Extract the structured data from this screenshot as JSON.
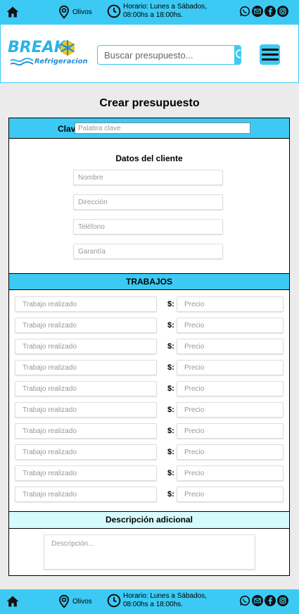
{
  "topbar": {
    "location": "Olivos",
    "hours": "Horario: Lunes a Sábados, 08:00hs a 18:00hs."
  },
  "header": {
    "logo_main": "BREAK",
    "logo_sub": "Refrigeracion",
    "search_placeholder": "Buscar presupuesto..."
  },
  "page": {
    "title": "Crear presupuesto"
  },
  "form": {
    "clave_label": "Clave:",
    "clave_placeholder": "Palabra clave",
    "client_title": "Datos del cliente",
    "client_fields": [
      "Nombre",
      "Dirección",
      "Teléfono",
      "Garantía"
    ],
    "trabajos_title": "TRABAJOS",
    "trabajo_placeholder": "Trabajo realizado",
    "currency": "$:",
    "precio_placeholder": "Precio",
    "trabajos_count": 10,
    "descripcion_title": "Descripción adicional",
    "descripcion_placeholder": "Descripción..."
  },
  "bottombar": {
    "location": "Olivos",
    "hours": "Horario: Lunes a Sábados, 08:00hs a 18:00hs."
  },
  "colors": {
    "accent": "#3ccaf5",
    "desc_header": "#d6fbfd"
  }
}
